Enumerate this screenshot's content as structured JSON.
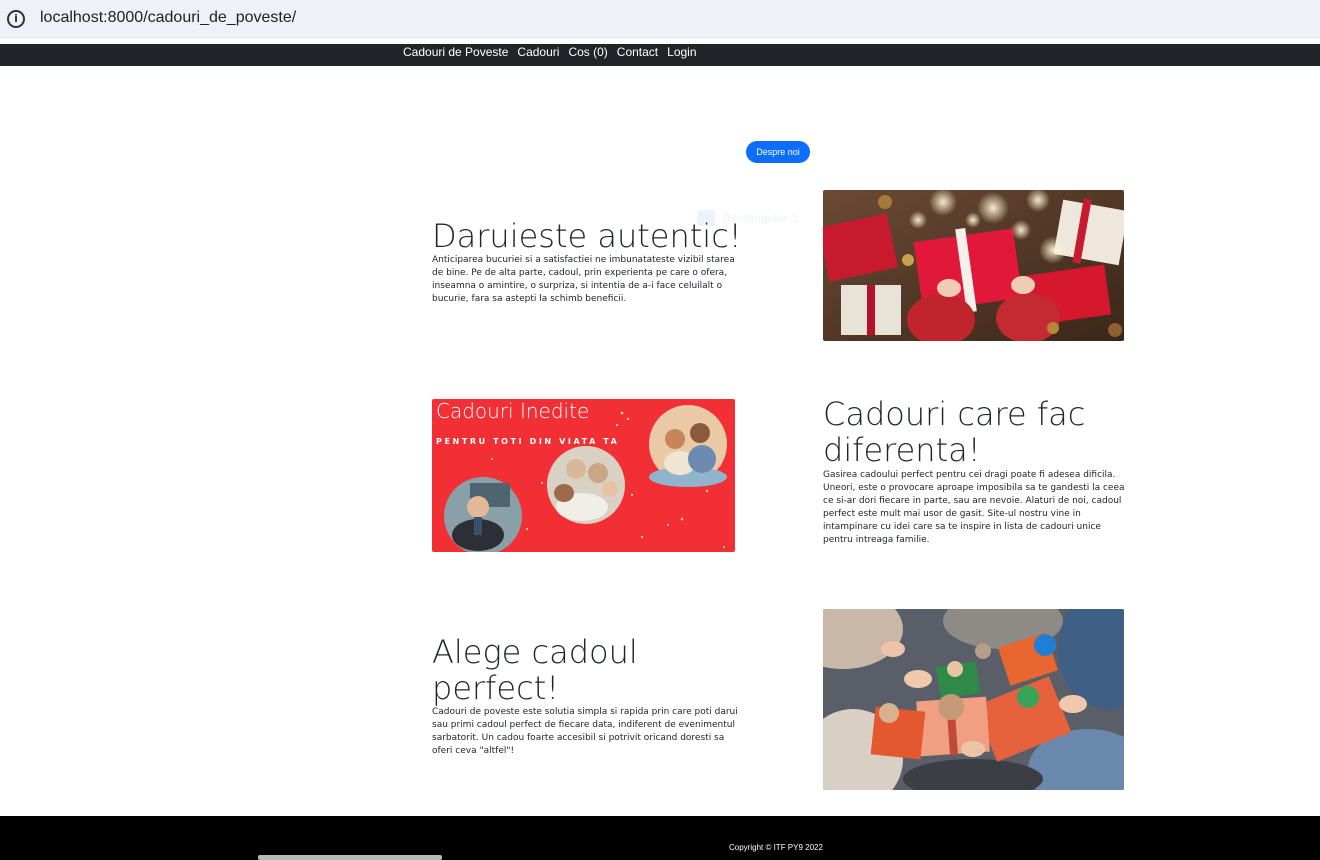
{
  "browser": {
    "url": "localhost:8000/cadouri_de_poveste/"
  },
  "nav": {
    "links": [
      "Cadouri de Poveste",
      "Cadouri",
      "Cos (0)",
      "Contact",
      "Login"
    ]
  },
  "about_button": "Despre noi",
  "ghost_text": "Rectangular S",
  "sections": [
    {
      "title": "Daruieste autentic!",
      "text": "Anticiparea bucuriei si a satisfactiei ne imbunatateste vizibil starea de bine. Pe de alta parte, cadoul, prin experienta pe care o ofera, inseamna o amintire, o surpriza, si intentia de a-i face celuilalt o bucurie, fara sa astepti la schimb beneficii."
    },
    {
      "title": "Cadouri care fac diferenta!",
      "text": "Gasirea cadoului perfect pentru cei dragi poate fi adesea dificila. Uneori, este o provocare aproape imposibila sa te gandesti la ceea ce si-ar dori fiecare in parte, sau are nevoie. Alaturi de noi, cadoul perfect este mult mai usor de gasit. Site-ul nostru vine in intampinare cu idei care sa te inspire in lista de cadouri unice pentru intreaga familie.",
      "banner": {
        "title": "Cadouri Inedite",
        "subtitle": "PENTRU TOTI DIN VIATA TA"
      }
    },
    {
      "title": "Alege cadoul perfect!",
      "text": "Cadouri de poveste este solutia simpla si rapida prin care poti darui sau primi cadoul perfect de fiecare data, indiferent de evenimentul sarbatorit. Un cadou foarte accesibil si potrivit oricand doresti sa oferi ceva \"altfel\"!"
    }
  ],
  "footer": {
    "copyright": "Copyright © ITF PY9 2022"
  },
  "colors": {
    "navbar": "#212529",
    "accent": "#0d6efd",
    "banner_red": "#f12f35",
    "footer": "#000000"
  }
}
